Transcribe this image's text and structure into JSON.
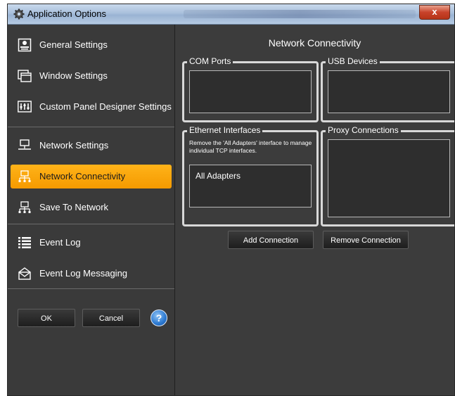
{
  "window": {
    "title": "Application Options",
    "close_label": "x"
  },
  "sidebar": {
    "items": [
      {
        "label": "General Settings",
        "icon": "general-settings-icon"
      },
      {
        "label": "Window Settings",
        "icon": "window-icon"
      },
      {
        "label": "Custom Panel Designer Settings",
        "icon": "panel-designer-icon"
      },
      {
        "label": "Network Settings",
        "icon": "network-icon"
      },
      {
        "label": "Network Connectivity",
        "icon": "network-icon",
        "active": true
      },
      {
        "label": "Save To Network",
        "icon": "network-icon"
      },
      {
        "label": "Event Log",
        "icon": "list-icon"
      },
      {
        "label": "Event Log Messaging",
        "icon": "envelope-icon"
      }
    ],
    "ok_label": "OK",
    "cancel_label": "Cancel",
    "help_label": "?"
  },
  "main": {
    "title": "Network Connectivity",
    "groups": {
      "com_ports": "COM Ports",
      "usb_devices": "USB Devices",
      "ethernet_interfaces": "Ethernet Interfaces",
      "ethernet_note": "Remove the 'All Adapters' interface to manage individual TCP interfaces.",
      "ethernet_items": [
        "All Adapters"
      ],
      "proxy_connections": "Proxy Connections"
    },
    "add_connection_label": "Add Connection",
    "remove_connection_label": "Remove Connection"
  },
  "colors": {
    "accent": "#f7a30a",
    "panel": "#3c3c3c",
    "border": "#d8d8d8"
  }
}
